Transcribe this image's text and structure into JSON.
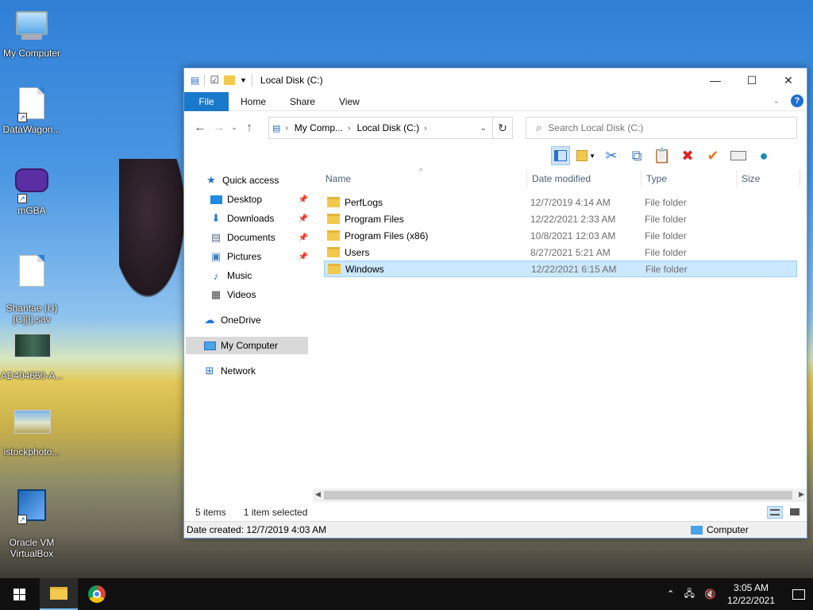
{
  "desktop": {
    "icons": [
      {
        "label": "My Computer"
      },
      {
        "label": "DataWagon..."
      },
      {
        "label": "mGBA"
      },
      {
        "label": "Shantae (U)\n[C][!].sav"
      },
      {
        "label": "AD404660-A..."
      },
      {
        "label": "istockphoto..."
      },
      {
        "label": "Oracle VM\nVirtualBox"
      }
    ]
  },
  "window": {
    "title": "Local Disk (C:)",
    "ribbon_tabs": [
      "File",
      "Home",
      "Share",
      "View"
    ],
    "address": {
      "crumbs": [
        "My Comp...",
        "Local Disk (C:)"
      ]
    },
    "search_placeholder": "Search Local Disk (C:)",
    "columns": [
      "Name",
      "Date modified",
      "Type",
      "Size"
    ],
    "nav": {
      "quick_access": "Quick access",
      "items": [
        "Desktop",
        "Downloads",
        "Documents",
        "Pictures",
        "Music",
        "Videos"
      ],
      "onedrive": "OneDrive",
      "computer": "My Computer",
      "network": "Network"
    },
    "files": [
      {
        "name": "PerfLogs",
        "date": "12/7/2019 4:14 AM",
        "type": "File folder"
      },
      {
        "name": "Program Files",
        "date": "12/22/2021 2:33 AM",
        "type": "File folder"
      },
      {
        "name": "Program Files (x86)",
        "date": "10/8/2021 12:03 AM",
        "type": "File folder"
      },
      {
        "name": "Users",
        "date": "8/27/2021 5:21 AM",
        "type": "File folder"
      },
      {
        "name": "Windows",
        "date": "12/22/2021 6:15 AM",
        "type": "File folder",
        "selected": true
      }
    ],
    "status": {
      "count": "5 items",
      "selection": "1 item selected"
    },
    "details": {
      "date_created": "Date created: 12/7/2019 4:03 AM",
      "location": "Computer"
    }
  },
  "taskbar": {
    "time": "3:05 AM",
    "date": "12/22/2021"
  },
  "colors": {
    "accent": "#1979ca",
    "selection": "#cce8ff",
    "taskbar": "#101010"
  }
}
